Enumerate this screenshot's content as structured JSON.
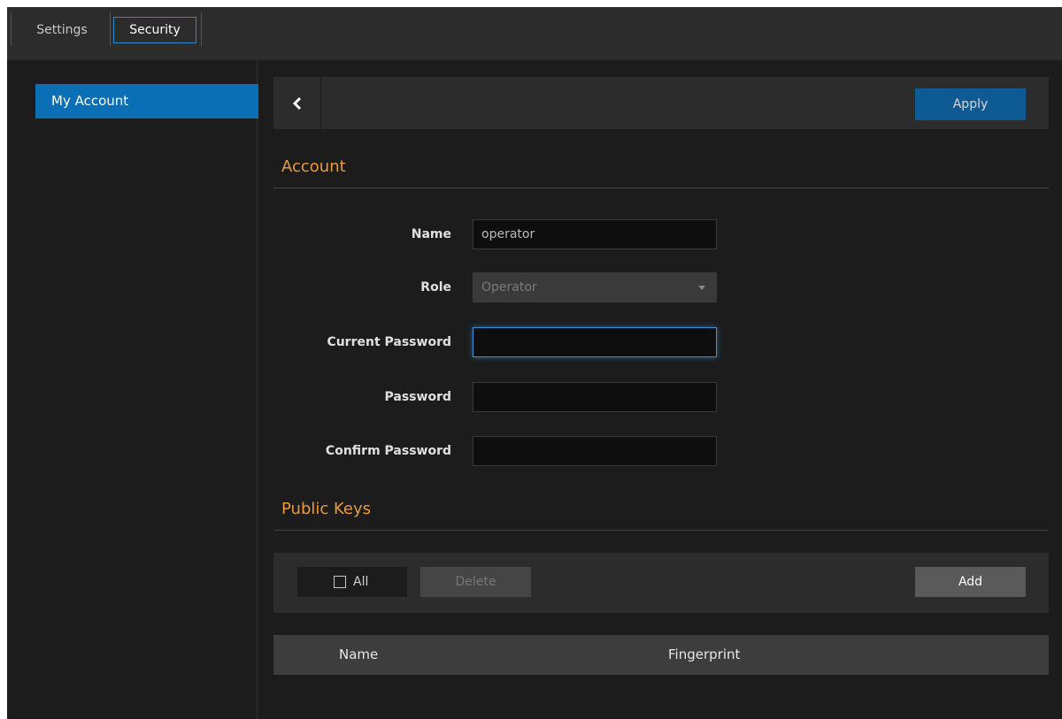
{
  "tabs": [
    {
      "label": "Settings"
    },
    {
      "label": "Security"
    }
  ],
  "sidebar": {
    "items": [
      {
        "label": "My Account"
      }
    ]
  },
  "toolbar": {
    "apply_label": "Apply"
  },
  "account": {
    "section_title": "Account",
    "fields": {
      "name": {
        "label": "Name",
        "value": "operator"
      },
      "role": {
        "label": "Role",
        "value": "Operator"
      },
      "current_password": {
        "label": "Current Password",
        "value": ""
      },
      "password": {
        "label": "Password",
        "value": ""
      },
      "confirm_password": {
        "label": "Confirm Password",
        "value": ""
      }
    }
  },
  "public_keys": {
    "section_title": "Public Keys",
    "select_all_label": "All",
    "delete_label": "Delete",
    "add_label": "Add",
    "columns": [
      "Name",
      "Fingerprint"
    ]
  },
  "colors": {
    "accent_blue": "#0b6fb5",
    "section_orange": "#e89a3c"
  }
}
